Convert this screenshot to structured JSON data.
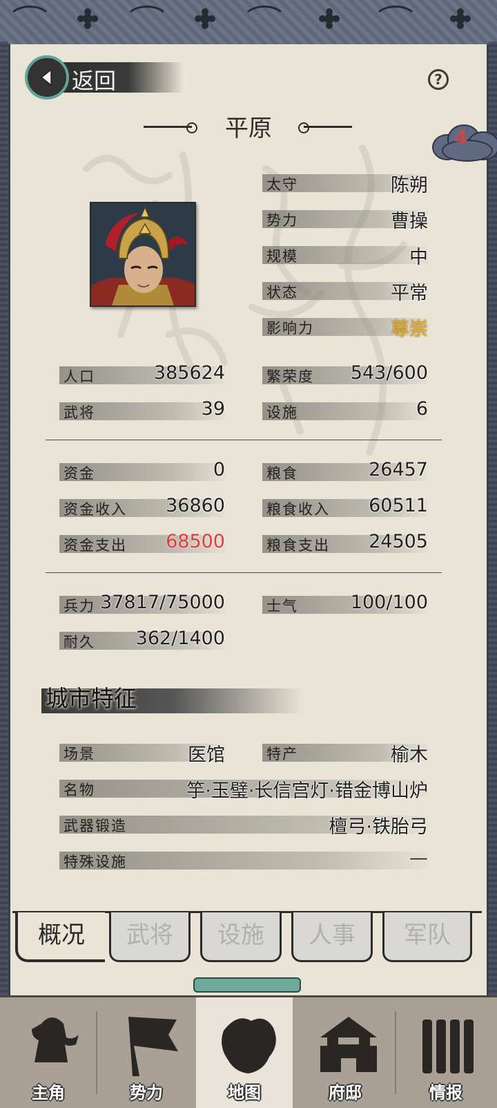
{
  "header": {
    "back_label": "返回",
    "help_label": "?",
    "city_name": "平原",
    "badge_count": "4"
  },
  "info": [
    {
      "label": "太守",
      "value": "陈朔"
    },
    {
      "label": "势力",
      "value": "曹操"
    },
    {
      "label": "规模",
      "value": "中"
    },
    {
      "label": "状态",
      "value": "平常"
    },
    {
      "label": "影响力",
      "value": "尊崇"
    }
  ],
  "stats1": {
    "population_label": "人口",
    "population": "385624",
    "prosperity_label": "繁荣度",
    "prosperity": "543/600",
    "generals_label": "武将",
    "generals": "39",
    "facilities_label": "设施",
    "facilities": "6"
  },
  "stats2": {
    "funds_label": "资金",
    "funds": "0",
    "grain_label": "粮食",
    "grain": "26457",
    "funds_income_label": "资金收入",
    "funds_income": "36860",
    "grain_income_label": "粮食收入",
    "grain_income": "60511",
    "funds_expense_label": "资金支出",
    "funds_expense": "68500",
    "grain_expense_label": "粮食支出",
    "grain_expense": "24505"
  },
  "stats3": {
    "troops_label": "兵力",
    "troops": "37817/75000",
    "morale_label": "士气",
    "morale": "100/100",
    "durability_label": "耐久",
    "durability": "362/1400"
  },
  "features": {
    "title": "城市特征",
    "scene_label": "场景",
    "scene": "医馆",
    "specialty_label": "特产",
    "specialty": "榆木",
    "famous_label": "名物",
    "famous": "竽·玉璧·长信宫灯·错金博山炉",
    "forge_label": "武器锻造",
    "forge": "檀弓·铁胎弓",
    "special_facility_label": "特殊设施",
    "special_facility": "—"
  },
  "tabs": [
    "概况",
    "武将",
    "设施",
    "人事",
    "军队"
  ],
  "nav": [
    "主角",
    "势力",
    "地图",
    "府邸",
    "情报"
  ],
  "colors": {
    "highlight_gold": "#f2b21c",
    "warning_red": "#e03a3a",
    "accent_teal": "#5fa497"
  }
}
